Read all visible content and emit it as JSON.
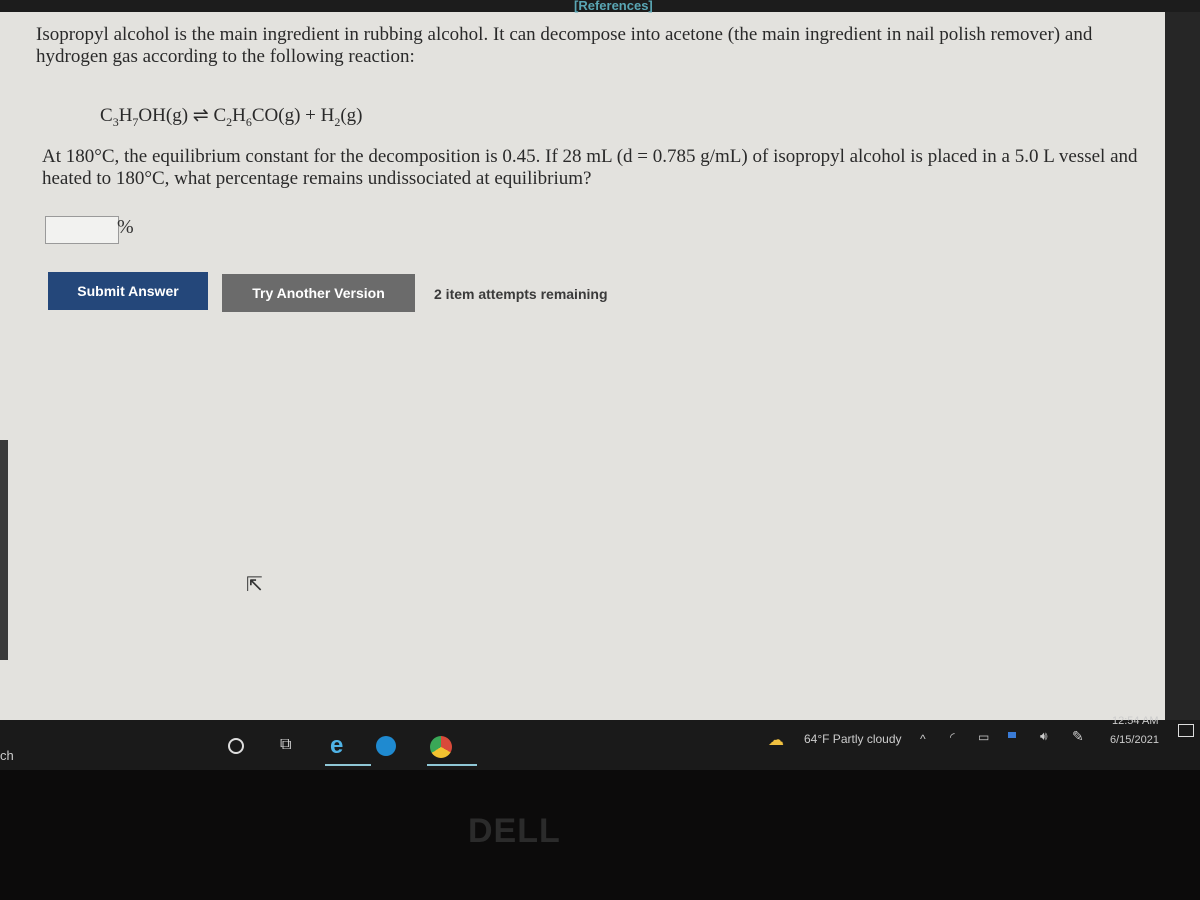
{
  "header": {
    "references_link": "[References]"
  },
  "question": {
    "intro": "Isopropyl alcohol is the main ingredient in rubbing alcohol. It can decompose into acetone (the main ingredient in nail polish remover) and hydrogen gas according to the following reaction:",
    "equation": {
      "c1": "C",
      "s1": "3",
      "h1": "H",
      "s2": "7",
      "oh": "OH(g) ⇌ C",
      "s3": "2",
      "h2": "H",
      "s4": "6",
      "co": "CO(g) + H",
      "s5": "2",
      "end": "(g)"
    },
    "body": "At 180°C, the equilibrium constant for the decomposition is 0.45. If 28 mL (d = 0.785 g/mL) of isopropyl alcohol is placed in a 5.0 L vessel and heated to 180°C, what percentage remains undissociated at equilibrium?",
    "answer_value": "",
    "unit": "%"
  },
  "actions": {
    "submit": "Submit Answer",
    "try_another": "Try Another Version",
    "attempts": "2 item attempts remaining"
  },
  "taskbar": {
    "search_partial": "ch",
    "weather": "64°F  Partly cloudy",
    "time": "12:54 AM",
    "date": "6/15/2021",
    "icons": [
      "cortana-icon",
      "task-view-icon",
      "internet-explorer-icon",
      "edge-icon",
      "chrome-icon"
    ]
  },
  "bezel": {
    "logo": "DELL"
  },
  "colors": {
    "submit": "#24477a",
    "try": "#6b6b6b",
    "references": "#5aa6b4"
  }
}
